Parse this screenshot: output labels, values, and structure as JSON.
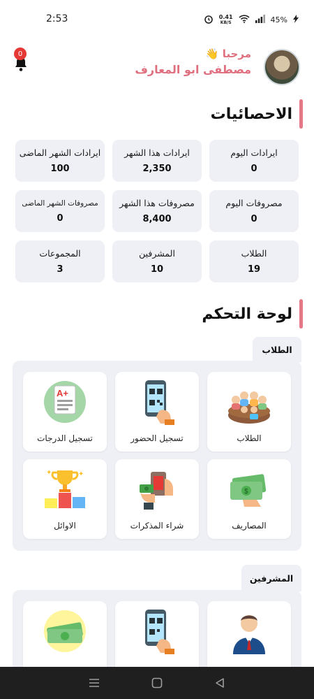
{
  "status_bar": {
    "time": "2:53",
    "net_speed_value": "0.41",
    "net_speed_unit": "KB/S",
    "battery": "45%"
  },
  "header": {
    "greeting": "مرحبا 👋",
    "user_name": "مصطفى ابو المعارف",
    "notification_count": "0"
  },
  "stats": {
    "title": "الاحصائيات",
    "cards": [
      {
        "label": "ايرادات اليوم",
        "value": "0"
      },
      {
        "label": "ايرادات هذا الشهر",
        "value": "2,350"
      },
      {
        "label": "ايرادات الشهر الماضى",
        "value": "100"
      },
      {
        "label": "مصروفات اليوم",
        "value": "0"
      },
      {
        "label": "مصروفات هذا الشهر",
        "value": "8,400"
      },
      {
        "label": "مصروفات الشهر الماضى",
        "value": "0"
      },
      {
        "label": "الطلاب",
        "value": "19"
      },
      {
        "label": "المشرفين",
        "value": "10"
      },
      {
        "label": "المجموعات",
        "value": "3"
      }
    ]
  },
  "dashboard": {
    "title": "لوحة التحكم",
    "students_group": {
      "label": "الطلاب",
      "tiles": [
        {
          "label": "الطلاب",
          "icon": "students-classroom-icon"
        },
        {
          "label": "تسجيل الحضور",
          "icon": "qr-phone-icon"
        },
        {
          "label": "تسجيل الدرجات",
          "icon": "grade-sheet-icon"
        },
        {
          "label": "المصاريف",
          "icon": "money-hand-icon"
        },
        {
          "label": "شراء المذكرات",
          "icon": "buy-notes-icon"
        },
        {
          "label": "الاوائل",
          "icon": "trophy-podium-icon"
        }
      ]
    },
    "supervisors_group": {
      "label": "المشرفين",
      "tiles": [
        {
          "label": "",
          "icon": "supervisor-person-icon"
        },
        {
          "label": "",
          "icon": "qr-phone-icon"
        },
        {
          "label": "",
          "icon": "money-stack-icon"
        }
      ]
    }
  },
  "colors": {
    "accent": "#e47886",
    "card_bg": "#eef0f5",
    "badge": "#e53935"
  }
}
